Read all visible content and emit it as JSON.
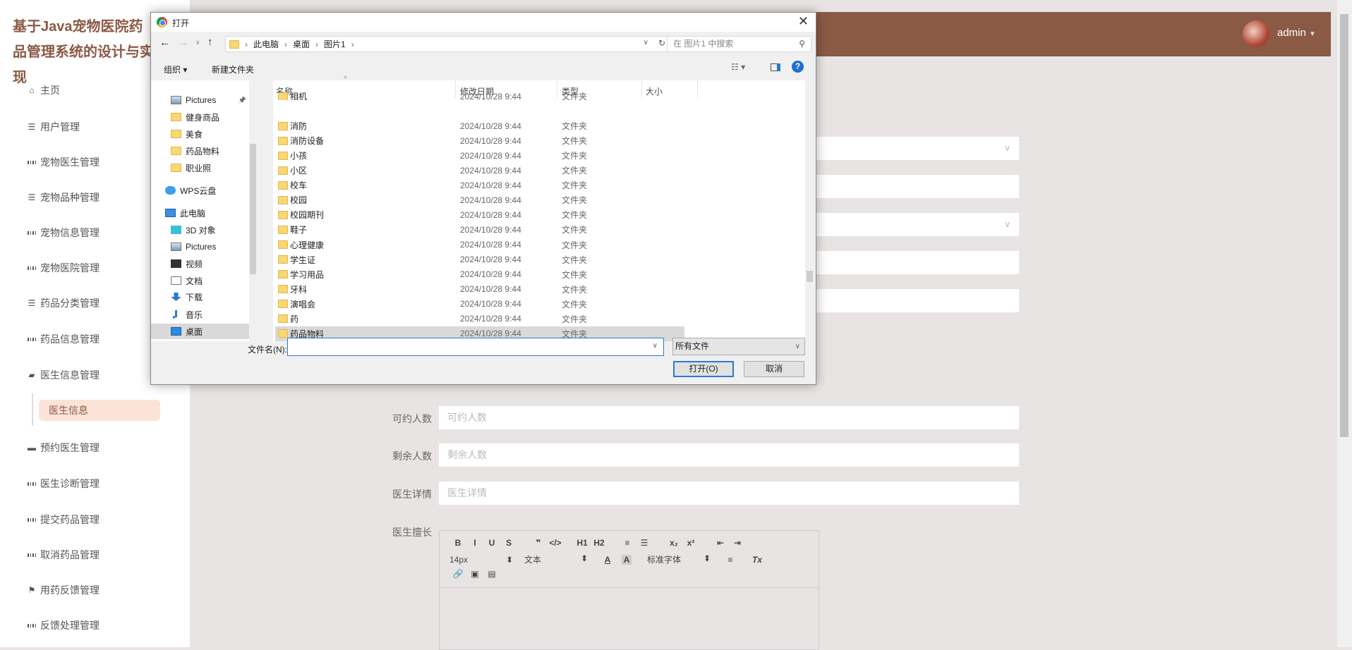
{
  "app": {
    "title": "基于Java宠物医院药品管理系统的设计与实现"
  },
  "sidebar": {
    "items": [
      {
        "label": "主页",
        "icon": "home"
      },
      {
        "label": "用户管理",
        "icon": "sliders"
      },
      {
        "label": "宠物医生管理",
        "icon": "grid"
      },
      {
        "label": "宠物品种管理",
        "icon": "list"
      },
      {
        "label": "宠物信息管理",
        "icon": "grid"
      },
      {
        "label": "宠物医院管理",
        "icon": "grid"
      },
      {
        "label": "药品分类管理",
        "icon": "list"
      },
      {
        "label": "药品信息管理",
        "icon": "grid"
      },
      {
        "label": "医生信息管理",
        "icon": "briefcase"
      },
      {
        "label": "预约医生管理",
        "icon": "chat"
      },
      {
        "label": "医生诊断管理",
        "icon": "grid"
      },
      {
        "label": "提交药品管理",
        "icon": "grid"
      },
      {
        "label": "取消药品管理",
        "icon": "grid"
      },
      {
        "label": "用药反馈管理",
        "icon": "flag"
      },
      {
        "label": "反馈处理管理",
        "icon": "grid"
      }
    ],
    "sub_item": "医生信息"
  },
  "header": {
    "user": "admin",
    "accent": "#8a5a45"
  },
  "form": {
    "fields": [
      {
        "label": "可约人数",
        "placeholder": "可约人数"
      },
      {
        "label": "剩余人数",
        "placeholder": "剩余人数"
      },
      {
        "label": "医生详情",
        "placeholder": "医生详情"
      }
    ],
    "editor_label": "医生擅长",
    "toolbar_row1": [
      "B",
      "I",
      "U",
      "S",
      "❞",
      "</>",
      "H1",
      "H2",
      "≡",
      "☰",
      "x₂",
      "x²",
      "⇤",
      "⇥"
    ],
    "font_size": "14px",
    "text_style": "文本",
    "font_family": "标准字体",
    "toolbar_row2_icons": [
      "A",
      "A",
      "≡",
      "Tx"
    ],
    "toolbar_row3": [
      "🔗",
      "▣",
      "▤"
    ]
  },
  "dialog": {
    "title": "打开",
    "breadcrumb": [
      "此电脑",
      "桌面",
      "图片1"
    ],
    "search_placeholder": "在 图片1 中搜索",
    "organize": "组织 ▾",
    "new_folder": "新建文件夹",
    "nav": [
      {
        "label": "Pictures",
        "icon": "pictures"
      },
      {
        "label": "健身商品",
        "icon": "folder"
      },
      {
        "label": "美食",
        "icon": "folder"
      },
      {
        "label": "药品物料",
        "icon": "folder"
      },
      {
        "label": "职业照",
        "icon": "folder"
      },
      {
        "label": "WPS云盘",
        "icon": "cloud"
      },
      {
        "label": "此电脑",
        "icon": "computer"
      },
      {
        "label": "3D 对象",
        "icon": "cube"
      },
      {
        "label": "Pictures",
        "icon": "pictures"
      },
      {
        "label": "视频",
        "icon": "video"
      },
      {
        "label": "文档",
        "icon": "document"
      },
      {
        "label": "下载",
        "icon": "download"
      },
      {
        "label": "音乐",
        "icon": "music"
      },
      {
        "label": "桌面",
        "icon": "desktop",
        "selected": true
      }
    ],
    "columns": [
      "名称",
      "修改日期",
      "类型",
      "大小"
    ],
    "files": [
      {
        "name": "相机",
        "date": "2024/10/28 9:44",
        "type": "文件夹"
      },
      {
        "name": "消防",
        "date": "2024/10/28 9:44",
        "type": "文件夹"
      },
      {
        "name": "消防设备",
        "date": "2024/10/28 9:44",
        "type": "文件夹"
      },
      {
        "name": "小孩",
        "date": "2024/10/28 9:44",
        "type": "文件夹"
      },
      {
        "name": "小区",
        "date": "2024/10/28 9:44",
        "type": "文件夹"
      },
      {
        "name": "校车",
        "date": "2024/10/28 9:44",
        "type": "文件夹"
      },
      {
        "name": "校园",
        "date": "2024/10/28 9:44",
        "type": "文件夹"
      },
      {
        "name": "校园期刊",
        "date": "2024/10/28 9:44",
        "type": "文件夹"
      },
      {
        "name": "鞋子",
        "date": "2024/10/28 9:44",
        "type": "文件夹"
      },
      {
        "name": "心理健康",
        "date": "2024/10/28 9:44",
        "type": "文件夹"
      },
      {
        "name": "学生证",
        "date": "2024/10/28 9:44",
        "type": "文件夹"
      },
      {
        "name": "学习用品",
        "date": "2024/10/28 9:44",
        "type": "文件夹"
      },
      {
        "name": "牙科",
        "date": "2024/10/28 9:44",
        "type": "文件夹"
      },
      {
        "name": "演唱会",
        "date": "2024/10/28 9:44",
        "type": "文件夹"
      },
      {
        "name": "药",
        "date": "2024/10/28 9:44",
        "type": "文件夹"
      },
      {
        "name": "药品物料",
        "date": "2024/10/28 9:44",
        "type": "文件夹",
        "selected": true
      }
    ],
    "filename_label": "文件名(N):",
    "filename_value": "",
    "filetype": "所有文件",
    "open_button": "打开(O)",
    "cancel_button": "取消"
  }
}
